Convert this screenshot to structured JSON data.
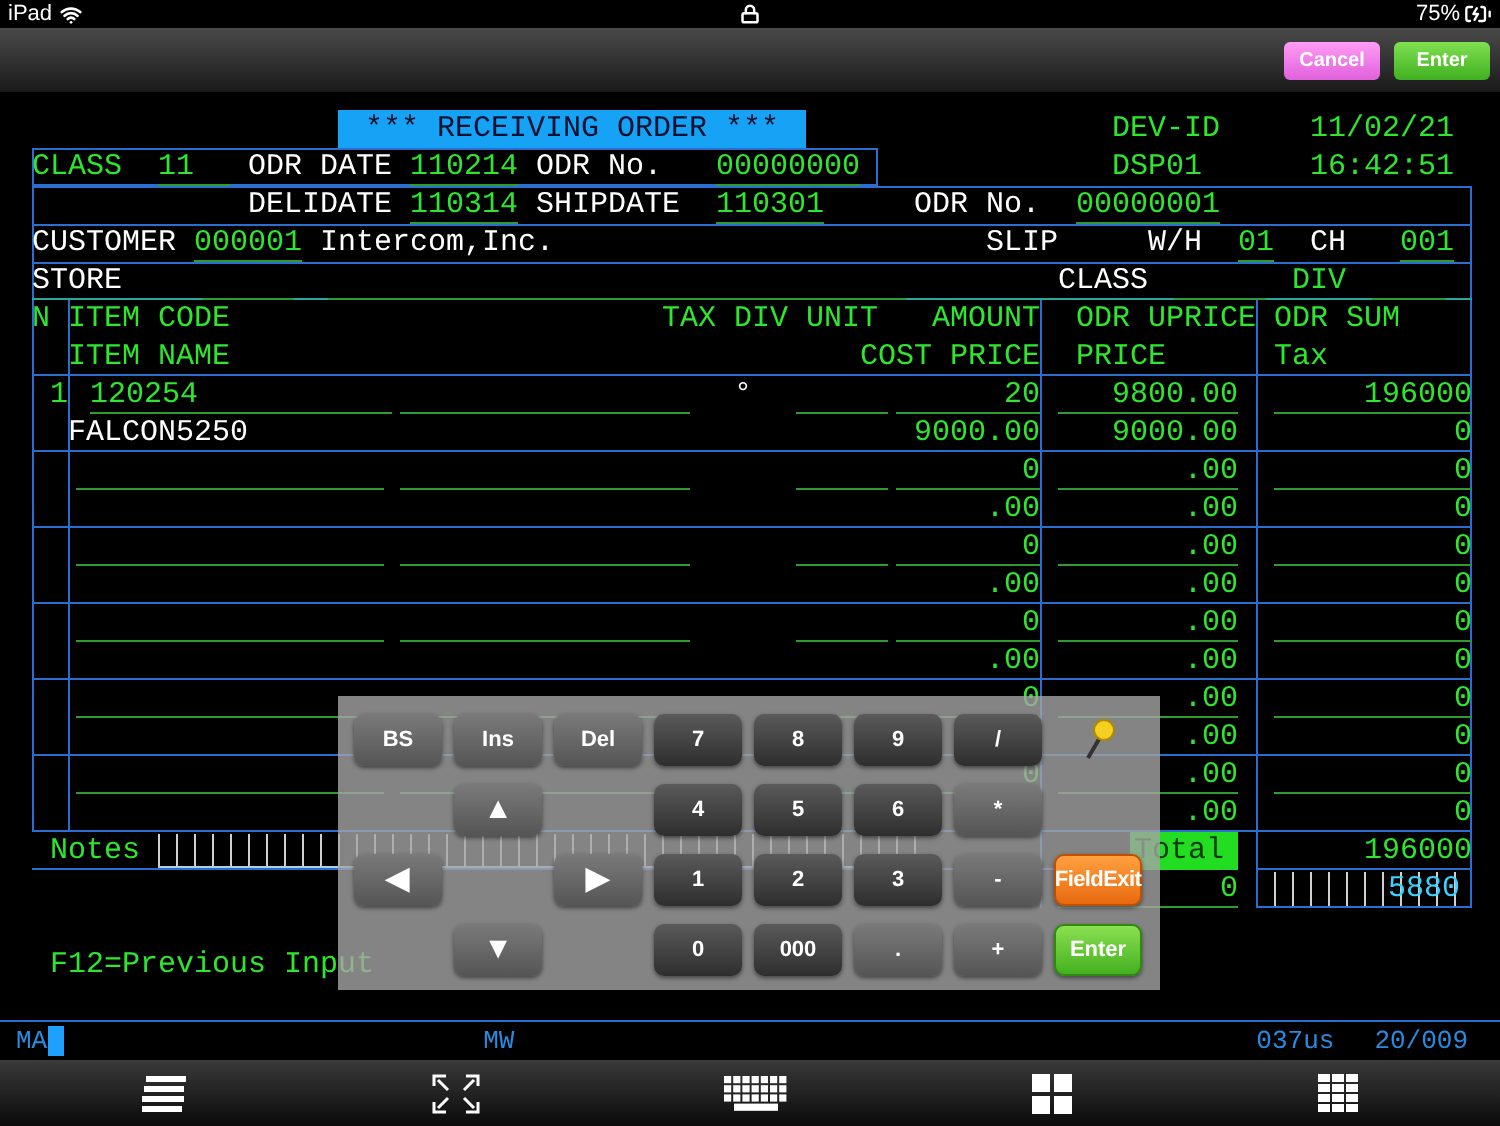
{
  "status_bar": {
    "device": "iPad",
    "battery": "75%"
  },
  "toolbar": {
    "buttons": [
      {
        "label": "Cancel",
        "kind": "cancel"
      },
      {
        "label": "Enter",
        "kind": "enter"
      }
    ]
  },
  "screen": {
    "lines": [
      {
        "cells": [
          {
            "text": "*** RECEIVING ORDER ***",
            "kind": "title"
          },
          {
            "text": "DEV-ID",
            "kind": "glabel"
          },
          {
            "text": "11/02/21",
            "kind": "glabel"
          }
        ]
      },
      {
        "cells": [
          {
            "text": "CLASS",
            "kind": "glabel"
          },
          {
            "text": "11",
            "kind": "field"
          },
          {
            "text": "ODR DATE",
            "kind": "label"
          },
          {
            "text": "110214",
            "kind": "field"
          },
          {
            "text": "ODR No.",
            "kind": "label"
          },
          {
            "text": "00000000",
            "kind": "field"
          },
          {
            "text": "DSP01",
            "kind": "glabel"
          },
          {
            "text": "16:42:51",
            "kind": "glabel"
          }
        ]
      },
      {
        "cells": [
          {
            "text": "DELIDATE",
            "kind": "label"
          },
          {
            "text": "110314",
            "kind": "field"
          },
          {
            "text": "SHIPDATE",
            "kind": "label"
          },
          {
            "text": "110301",
            "kind": "field"
          },
          {
            "text": "ODR No.",
            "kind": "label"
          },
          {
            "text": "00000001",
            "kind": "field"
          }
        ]
      },
      {
        "cells": [
          {
            "text": "CUSTOMER",
            "kind": "label"
          },
          {
            "text": "000001",
            "kind": "field"
          },
          {
            "text": "Intercom,Inc.",
            "kind": "label"
          },
          {
            "text": "SLIP",
            "kind": "label"
          },
          {
            "text": "W/H",
            "kind": "label"
          },
          {
            "text": "01",
            "kind": "field"
          },
          {
            "text": "CH",
            "kind": "label"
          },
          {
            "text": "001",
            "kind": "field"
          }
        ]
      },
      {
        "cells": [
          {
            "text": "STORE",
            "kind": "label"
          },
          {
            "text": "CLASS",
            "kind": "label"
          },
          {
            "text": "DIV",
            "kind": "glabel"
          }
        ]
      },
      {
        "cells": [
          {
            "text": "N",
            "kind": "glabel"
          },
          {
            "text": "ITEM CODE",
            "kind": "glabel"
          },
          {
            "text": "TAX DIV UNIT",
            "kind": "glabel"
          },
          {
            "text": "AMOUNT",
            "kind": "glabel"
          },
          {
            "text": "ODR UPRICE",
            "kind": "glabel"
          },
          {
            "text": "ODR SUM",
            "kind": "glabel"
          }
        ]
      },
      {
        "cells": [
          {
            "text": "ITEM NAME",
            "kind": "glabel"
          },
          {
            "text": "COST PRICE",
            "kind": "glabel"
          },
          {
            "text": "PRICE",
            "kind": "glabel"
          },
          {
            "text": "Tax",
            "kind": "glabel"
          }
        ]
      }
    ]
  },
  "items": [
    {
      "no": "1",
      "code": "120254",
      "mark": "°",
      "amount": "20",
      "uprice": "9800.00",
      "sum": "196000",
      "name": "FALCON5250",
      "cost": "9000.00",
      "price": "9000.00",
      "tax": "0"
    },
    {
      "amount": "0",
      "uprice": ".00",
      "sum": "0",
      "cost": ".00",
      "price": ".00",
      "tax": "0"
    },
    {
      "amount": "0",
      "uprice": ".00",
      "sum": "0",
      "cost": ".00",
      "price": ".00",
      "tax": "0"
    },
    {
      "amount": "0",
      "uprice": ".00",
      "sum": "0",
      "cost": ".00",
      "price": ".00",
      "tax": "0"
    },
    {
      "amount": "0",
      "uprice": ".00",
      "sum": "0",
      "price": ".00",
      "tax": "0"
    },
    {
      "amount": "0",
      "uprice": ".00",
      "sum": "0",
      "price": ".00",
      "tax": "0"
    }
  ],
  "totals": {
    "notes_label": "Notes",
    "total_label": "Total",
    "total": "196000",
    "tax": "0",
    "tax_amount": "5880"
  },
  "hint": "F12=Previous Input",
  "keypad": {
    "keys": [
      {
        "label": "BS",
        "kind": "function"
      },
      {
        "label": "Ins",
        "kind": "function"
      },
      {
        "label": "Del",
        "kind": "function"
      },
      {
        "label": "7",
        "kind": "digit"
      },
      {
        "label": "8",
        "kind": "digit"
      },
      {
        "label": "9",
        "kind": "digit"
      },
      {
        "label": "/",
        "kind": "digit"
      },
      {
        "kind": "pin"
      },
      {
        "kind": "blank"
      },
      {
        "label": "▲",
        "kind": "arrow"
      },
      {
        "kind": "blank"
      },
      {
        "label": "4",
        "kind": "digit"
      },
      {
        "label": "5",
        "kind": "digit"
      },
      {
        "label": "6",
        "kind": "digit"
      },
      {
        "label": "*",
        "kind": "function"
      },
      {
        "kind": "blank"
      },
      {
        "label": "◀",
        "kind": "arrow"
      },
      {
        "kind": "blank"
      },
      {
        "label": "▶",
        "kind": "arrow"
      },
      {
        "label": "1",
        "kind": "digit"
      },
      {
        "label": "2",
        "kind": "digit"
      },
      {
        "label": "3",
        "kind": "digit"
      },
      {
        "label": "-",
        "kind": "function"
      },
      {
        "label": "FieldExit",
        "kind": "fieldexit"
      },
      {
        "kind": "blank"
      },
      {
        "label": "▼",
        "kind": "arrow"
      },
      {
        "kind": "blank"
      },
      {
        "label": "0",
        "kind": "digit"
      },
      {
        "label": "000",
        "kind": "digit"
      },
      {
        "label": ".",
        "kind": "function"
      },
      {
        "label": "+",
        "kind": "function"
      },
      {
        "label": "Enter",
        "kind": "enter"
      }
    ]
  },
  "status_line": {
    "mode": "MA",
    "mode2": "MW",
    "response": "037us",
    "position": "20/009"
  }
}
